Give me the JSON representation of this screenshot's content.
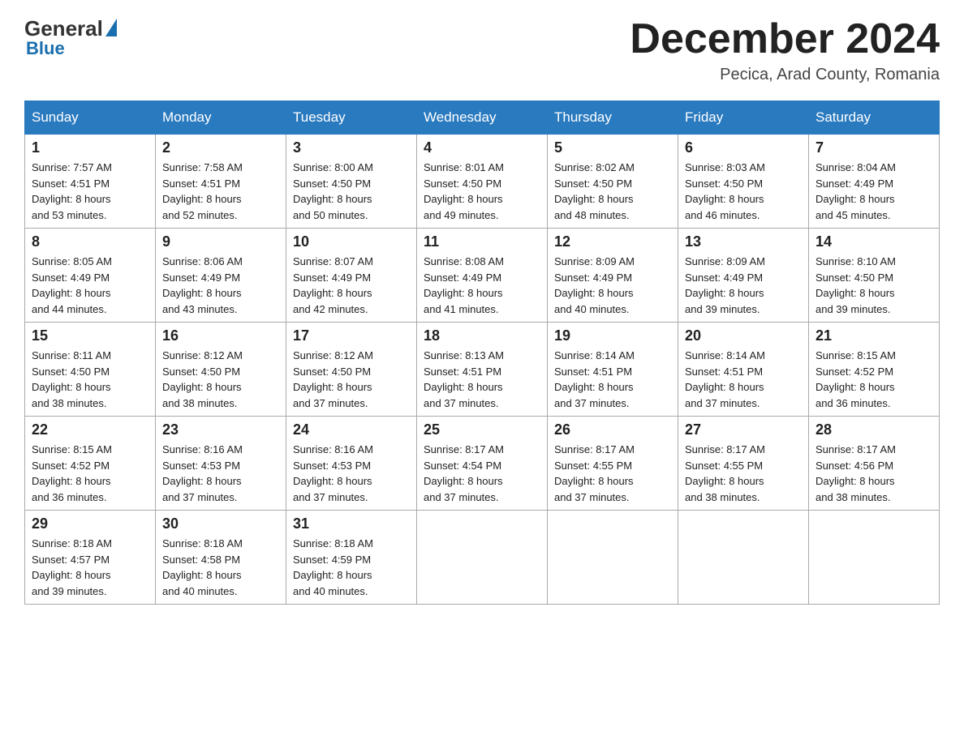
{
  "header": {
    "logo": {
      "general": "General",
      "blue": "Blue"
    },
    "title": "December 2024",
    "location": "Pecica, Arad County, Romania"
  },
  "weekdays": [
    "Sunday",
    "Monday",
    "Tuesday",
    "Wednesday",
    "Thursday",
    "Friday",
    "Saturday"
  ],
  "weeks": [
    [
      {
        "day": "1",
        "sunrise": "7:57 AM",
        "sunset": "4:51 PM",
        "daylight": "8 hours and 53 minutes."
      },
      {
        "day": "2",
        "sunrise": "7:58 AM",
        "sunset": "4:51 PM",
        "daylight": "8 hours and 52 minutes."
      },
      {
        "day": "3",
        "sunrise": "8:00 AM",
        "sunset": "4:50 PM",
        "daylight": "8 hours and 50 minutes."
      },
      {
        "day": "4",
        "sunrise": "8:01 AM",
        "sunset": "4:50 PM",
        "daylight": "8 hours and 49 minutes."
      },
      {
        "day": "5",
        "sunrise": "8:02 AM",
        "sunset": "4:50 PM",
        "daylight": "8 hours and 48 minutes."
      },
      {
        "day": "6",
        "sunrise": "8:03 AM",
        "sunset": "4:50 PM",
        "daylight": "8 hours and 46 minutes."
      },
      {
        "day": "7",
        "sunrise": "8:04 AM",
        "sunset": "4:49 PM",
        "daylight": "8 hours and 45 minutes."
      }
    ],
    [
      {
        "day": "8",
        "sunrise": "8:05 AM",
        "sunset": "4:49 PM",
        "daylight": "8 hours and 44 minutes."
      },
      {
        "day": "9",
        "sunrise": "8:06 AM",
        "sunset": "4:49 PM",
        "daylight": "8 hours and 43 minutes."
      },
      {
        "day": "10",
        "sunrise": "8:07 AM",
        "sunset": "4:49 PM",
        "daylight": "8 hours and 42 minutes."
      },
      {
        "day": "11",
        "sunrise": "8:08 AM",
        "sunset": "4:49 PM",
        "daylight": "8 hours and 41 minutes."
      },
      {
        "day": "12",
        "sunrise": "8:09 AM",
        "sunset": "4:49 PM",
        "daylight": "8 hours and 40 minutes."
      },
      {
        "day": "13",
        "sunrise": "8:09 AM",
        "sunset": "4:49 PM",
        "daylight": "8 hours and 39 minutes."
      },
      {
        "day": "14",
        "sunrise": "8:10 AM",
        "sunset": "4:50 PM",
        "daylight": "8 hours and 39 minutes."
      }
    ],
    [
      {
        "day": "15",
        "sunrise": "8:11 AM",
        "sunset": "4:50 PM",
        "daylight": "8 hours and 38 minutes."
      },
      {
        "day": "16",
        "sunrise": "8:12 AM",
        "sunset": "4:50 PM",
        "daylight": "8 hours and 38 minutes."
      },
      {
        "day": "17",
        "sunrise": "8:12 AM",
        "sunset": "4:50 PM",
        "daylight": "8 hours and 37 minutes."
      },
      {
        "day": "18",
        "sunrise": "8:13 AM",
        "sunset": "4:51 PM",
        "daylight": "8 hours and 37 minutes."
      },
      {
        "day": "19",
        "sunrise": "8:14 AM",
        "sunset": "4:51 PM",
        "daylight": "8 hours and 37 minutes."
      },
      {
        "day": "20",
        "sunrise": "8:14 AM",
        "sunset": "4:51 PM",
        "daylight": "8 hours and 37 minutes."
      },
      {
        "day": "21",
        "sunrise": "8:15 AM",
        "sunset": "4:52 PM",
        "daylight": "8 hours and 36 minutes."
      }
    ],
    [
      {
        "day": "22",
        "sunrise": "8:15 AM",
        "sunset": "4:52 PM",
        "daylight": "8 hours and 36 minutes."
      },
      {
        "day": "23",
        "sunrise": "8:16 AM",
        "sunset": "4:53 PM",
        "daylight": "8 hours and 37 minutes."
      },
      {
        "day": "24",
        "sunrise": "8:16 AM",
        "sunset": "4:53 PM",
        "daylight": "8 hours and 37 minutes."
      },
      {
        "day": "25",
        "sunrise": "8:17 AM",
        "sunset": "4:54 PM",
        "daylight": "8 hours and 37 minutes."
      },
      {
        "day": "26",
        "sunrise": "8:17 AM",
        "sunset": "4:55 PM",
        "daylight": "8 hours and 37 minutes."
      },
      {
        "day": "27",
        "sunrise": "8:17 AM",
        "sunset": "4:55 PM",
        "daylight": "8 hours and 38 minutes."
      },
      {
        "day": "28",
        "sunrise": "8:17 AM",
        "sunset": "4:56 PM",
        "daylight": "8 hours and 38 minutes."
      }
    ],
    [
      {
        "day": "29",
        "sunrise": "8:18 AM",
        "sunset": "4:57 PM",
        "daylight": "8 hours and 39 minutes."
      },
      {
        "day": "30",
        "sunrise": "8:18 AM",
        "sunset": "4:58 PM",
        "daylight": "8 hours and 40 minutes."
      },
      {
        "day": "31",
        "sunrise": "8:18 AM",
        "sunset": "4:59 PM",
        "daylight": "8 hours and 40 minutes."
      },
      null,
      null,
      null,
      null
    ]
  ],
  "labels": {
    "sunrise": "Sunrise:",
    "sunset": "Sunset:",
    "daylight": "Daylight:"
  }
}
